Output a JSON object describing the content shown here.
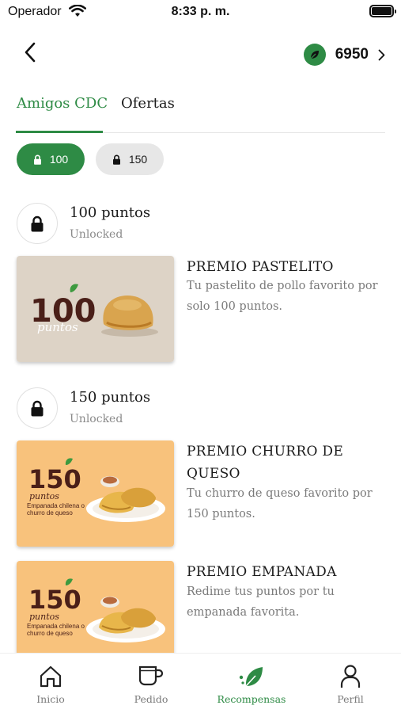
{
  "status_bar": {
    "carrier": "Operador",
    "time": "8:33 p. m."
  },
  "header": {
    "points": "6950"
  },
  "tabs": [
    {
      "label": "Amigos CDC",
      "active": true
    },
    {
      "label": "Ofertas",
      "active": false
    }
  ],
  "filters": [
    {
      "label": "100",
      "active": true
    },
    {
      "label": "150",
      "active": false
    }
  ],
  "tiers": [
    {
      "title": "100 puntos",
      "status": "Unlocked"
    },
    {
      "title": "150 puntos",
      "status": "Unlocked"
    }
  ],
  "rewards": [
    {
      "title": "PREMIO PASTELITO",
      "description": "Tu pastelito de pollo favorito por solo 100 puntos.",
      "image_number": "100",
      "image_word": "puntos"
    },
    {
      "title": "PREMIO CHURRO DE QUESO",
      "description": "Tu churro de queso favorito por 150 puntos.",
      "image_number": "150",
      "image_word": "puntos",
      "image_caption": "Empanada chilena o churro de queso"
    },
    {
      "title": "PREMIO EMPANADA",
      "description": "Redime tus puntos por tu empanada favorita.",
      "image_number": "150",
      "image_word": "puntos",
      "image_caption": "Empanada chilena o churro de queso"
    }
  ],
  "bottom_nav": [
    {
      "label": "Inicio",
      "icon": "home-icon"
    },
    {
      "label": "Pedido",
      "icon": "cup-icon"
    },
    {
      "label": "Recompensas",
      "icon": "leaf-icon",
      "active": true
    },
    {
      "label": "Perfil",
      "icon": "user-icon"
    }
  ],
  "colors": {
    "brand_green": "#2e8b45",
    "card_beige": "#ddd3c6",
    "card_orange": "#f8c27c",
    "brand_brown": "#4a1f18"
  }
}
